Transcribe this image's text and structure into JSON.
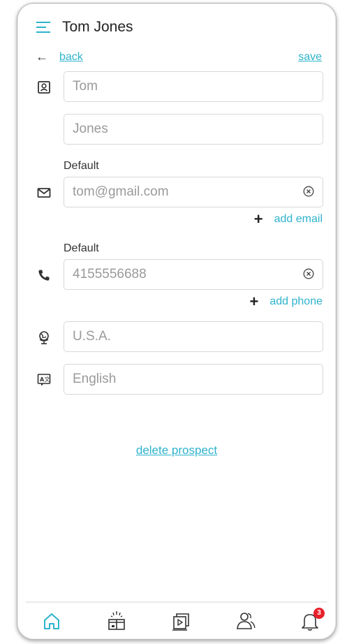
{
  "header": {
    "title": "Tom Jones",
    "menu_icon": "hamburger-menu-icon"
  },
  "nav": {
    "back_label": "back",
    "save_label": "save"
  },
  "form": {
    "first_name": "Tom",
    "last_name": "Jones",
    "email_label": "Default",
    "email": "tom@gmail.com",
    "add_email_label": "add email",
    "phone_label": "Default",
    "phone": "4155556688",
    "add_phone_label": "add phone",
    "country": "U.S.A.",
    "language": "English"
  },
  "delete_label": "delete prospect",
  "tabbar": {
    "items": [
      "home-icon",
      "gift-icon",
      "media-icon",
      "people-icon",
      "bell-icon"
    ],
    "notification_count": "3"
  },
  "colors": {
    "accent": "#2eb3cc",
    "badge": "#e8202a"
  }
}
